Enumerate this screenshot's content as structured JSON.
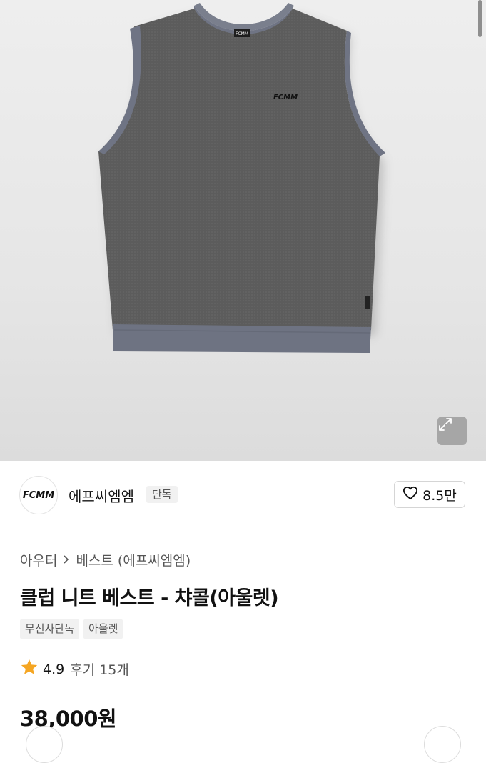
{
  "hero": {
    "garment_logo_text": "FCMM",
    "neck_tag_text": "FCMM",
    "expand_icon": "expand-arrows-icon"
  },
  "brand": {
    "logo_text": "FCMM",
    "name": "에프씨엠엠",
    "badge": "단독",
    "like_icon": "heart-outline-icon",
    "like_count": "8.5만"
  },
  "breadcrumb": {
    "category": "아우터",
    "separator_icon": "chevron-right-icon",
    "subcategory": "베스트 (에프씨엠엠)"
  },
  "product": {
    "title": "클럽 니트 베스트 - 챠콜(아울렛)",
    "tags": [
      "무신사단독",
      "아울렛"
    ],
    "rating_icon": "star-filled-icon",
    "rating": "4.9",
    "review_label": "후기 15개",
    "price": "38,000원"
  },
  "colors": {
    "star": "#f5a623",
    "vest_body": "#5b5b5b",
    "vest_rib": "#6f7484"
  }
}
